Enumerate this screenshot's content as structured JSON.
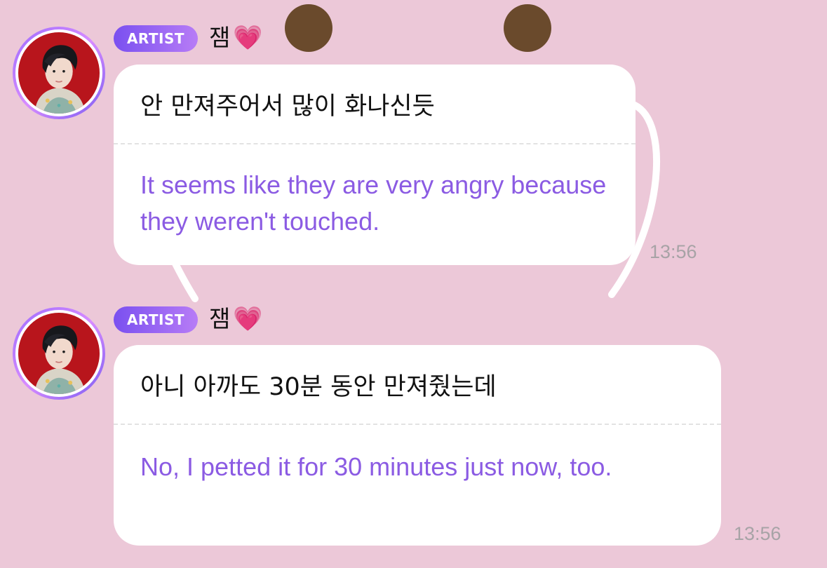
{
  "colors": {
    "background": "#ecc8d8",
    "bubble": "#ffffff",
    "badge_gradient_start": "#7a50f0",
    "badge_gradient_end": "#b77cf6",
    "translation_text": "#8b5be3",
    "timestamp": "#a7a3a6",
    "heart": "#e43a9c"
  },
  "messages": [
    {
      "badge": "ARTIST",
      "sender": "잼",
      "sender_emoji": "💗",
      "original": "안 만져주어서 많이 화나신듯",
      "translation": "It seems like they are very angry because they weren't touched.",
      "time": "13:56",
      "avatar_icon": "artist-avatar-photo"
    },
    {
      "badge": "ARTIST",
      "sender": "잼",
      "sender_emoji": "💗",
      "original": "아니 아까도 30분 동안 만져줬는데",
      "translation": "No, I petted it for 30 minutes just now, too.",
      "time": "13:56",
      "avatar_icon": "artist-avatar-photo"
    }
  ]
}
